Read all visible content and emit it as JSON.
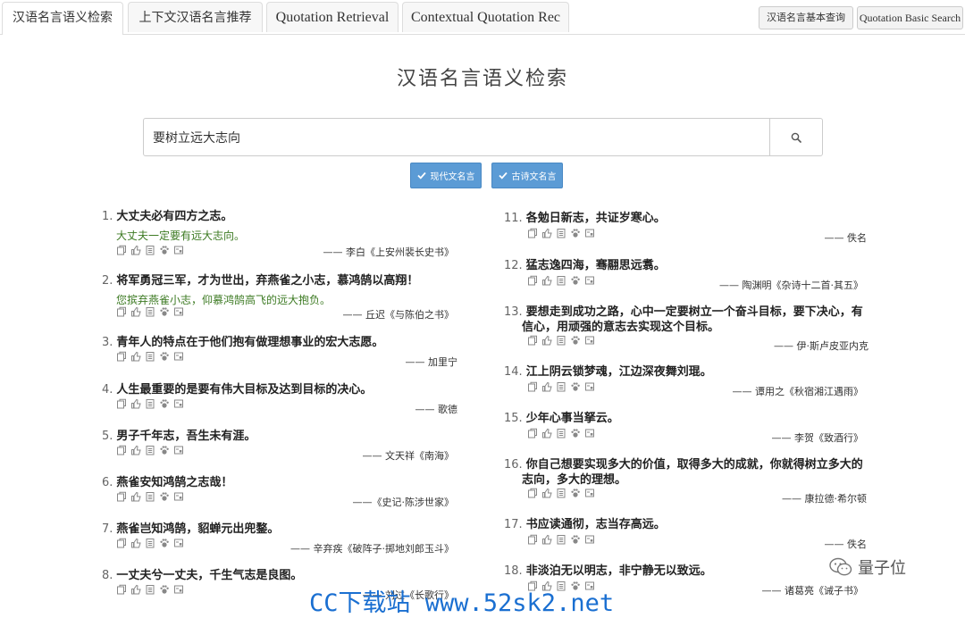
{
  "nav": {
    "tabs": [
      {
        "label": "汉语名言语义检索"
      },
      {
        "label": "上下文汉语名言推荐"
      },
      {
        "label": "Quotation Retrieval"
      },
      {
        "label": "Contextual Quotation Rec"
      }
    ],
    "right_buttons": [
      {
        "label": "汉语名言基本查询"
      },
      {
        "label": "Quotation Basic Search"
      }
    ]
  },
  "page": {
    "title": "汉语名言语义检索"
  },
  "search": {
    "value": "要树立远大志向",
    "placeholder": ""
  },
  "filters": [
    {
      "label": "现代文名言",
      "checked": true
    },
    {
      "label": "古诗文名言",
      "checked": true
    }
  ],
  "results_left": [
    {
      "num": "1.",
      "text": "大丈夫必有四方之志。",
      "translation": "大丈夫一定要有远大志向。",
      "author": "—— 李白《上安州裴长史书》"
    },
    {
      "num": "2.",
      "text": "将军勇冠三军，才为世出，弃燕雀之小志，慕鸿鹄以高翔！",
      "translation": "您摈弃燕雀小志，仰慕鸿鹄高飞的远大抱负。",
      "author": "—— 丘迟《与陈伯之书》"
    },
    {
      "num": "3.",
      "text": "青年人的特点在于他们抱有做理想事业的宏大志愿。",
      "translation": "",
      "author": "—— 加里宁"
    },
    {
      "num": "4.",
      "text": "人生最重要的是要有伟大目标及达到目标的决心。",
      "translation": "",
      "author": "—— 歌德"
    },
    {
      "num": "5.",
      "text": "男子千年志，吾生未有涯。",
      "translation": "",
      "author": "—— 文天祥《南海》"
    },
    {
      "num": "6.",
      "text": "燕雀安知鸿鹄之志哉！",
      "translation": "",
      "author": "——《史记·陈涉世家》"
    },
    {
      "num": "7.",
      "text": "燕雀岂知鸿鹄，貂蝉元出兜鍪。",
      "translation": "",
      "author": "—— 辛弃疾《破阵子·掷地刘郎玉斗》"
    },
    {
      "num": "8.",
      "text": "一丈夫兮一丈夫，千生气志是良图。",
      "translation": "",
      "author": "—— 刘过《长歌行》"
    }
  ],
  "results_right": [
    {
      "num": "11.",
      "text": "各勉日新志，共证岁寒心。",
      "author": "—— 佚名"
    },
    {
      "num": "12.",
      "text": "猛志逸四海，骞翮思远翥。",
      "author": "—— 陶渊明《杂诗十二首·其五》"
    },
    {
      "num": "13.",
      "text": "要想走到成功之路，心中一定要树立一个奋斗目标，要下决心，有信心，用顽强的意志去实现这个目标。",
      "author": "—— 伊·斯卢皮亚内克"
    },
    {
      "num": "14.",
      "text": "江上阴云锁梦魂，江边深夜舞刘琨。",
      "author": "—— 谭用之《秋宿湘江遇雨》"
    },
    {
      "num": "15.",
      "text": "少年心事当拏云。",
      "author": "—— 李贺《致酒行》"
    },
    {
      "num": "16.",
      "text": "你自己想要实现多大的价值，取得多大的成就，你就得树立多大的志向，多大的理想。",
      "author": "—— 康拉德·希尔顿"
    },
    {
      "num": "17.",
      "text": "书应读通彻，志当存高远。",
      "author": "—— 佚名"
    },
    {
      "num": "18.",
      "text": "非淡泊无以明志，非宁静无以致远。",
      "author": "—— 诸葛亮《诫子书》"
    }
  ],
  "watermark": {
    "text": "CC下载站 www.52sk2.net"
  },
  "wechat": {
    "label": "量子位"
  },
  "colors": {
    "accent": "#5b9bd5",
    "translation": "#3c7a22",
    "watermark": "#1a6fd1"
  }
}
